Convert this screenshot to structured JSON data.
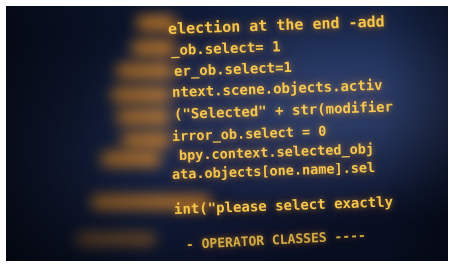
{
  "code_lines": [
    "election at the end -add",
    "_ob.select= 1",
    "er_ob.select=1",
    "ntext.scene.objects.activ",
    "(\"Selected\" + str(modifier",
    "irror_ob.select = 0",
    "bpy.context.selected_obj",
    "ata.objects[one.name].sel",
    "int(\"please select exactly",
    "- OPERATOR CLASSES ----"
  ],
  "accent_color": "#f6c64a",
  "background_color": "#0a1228"
}
